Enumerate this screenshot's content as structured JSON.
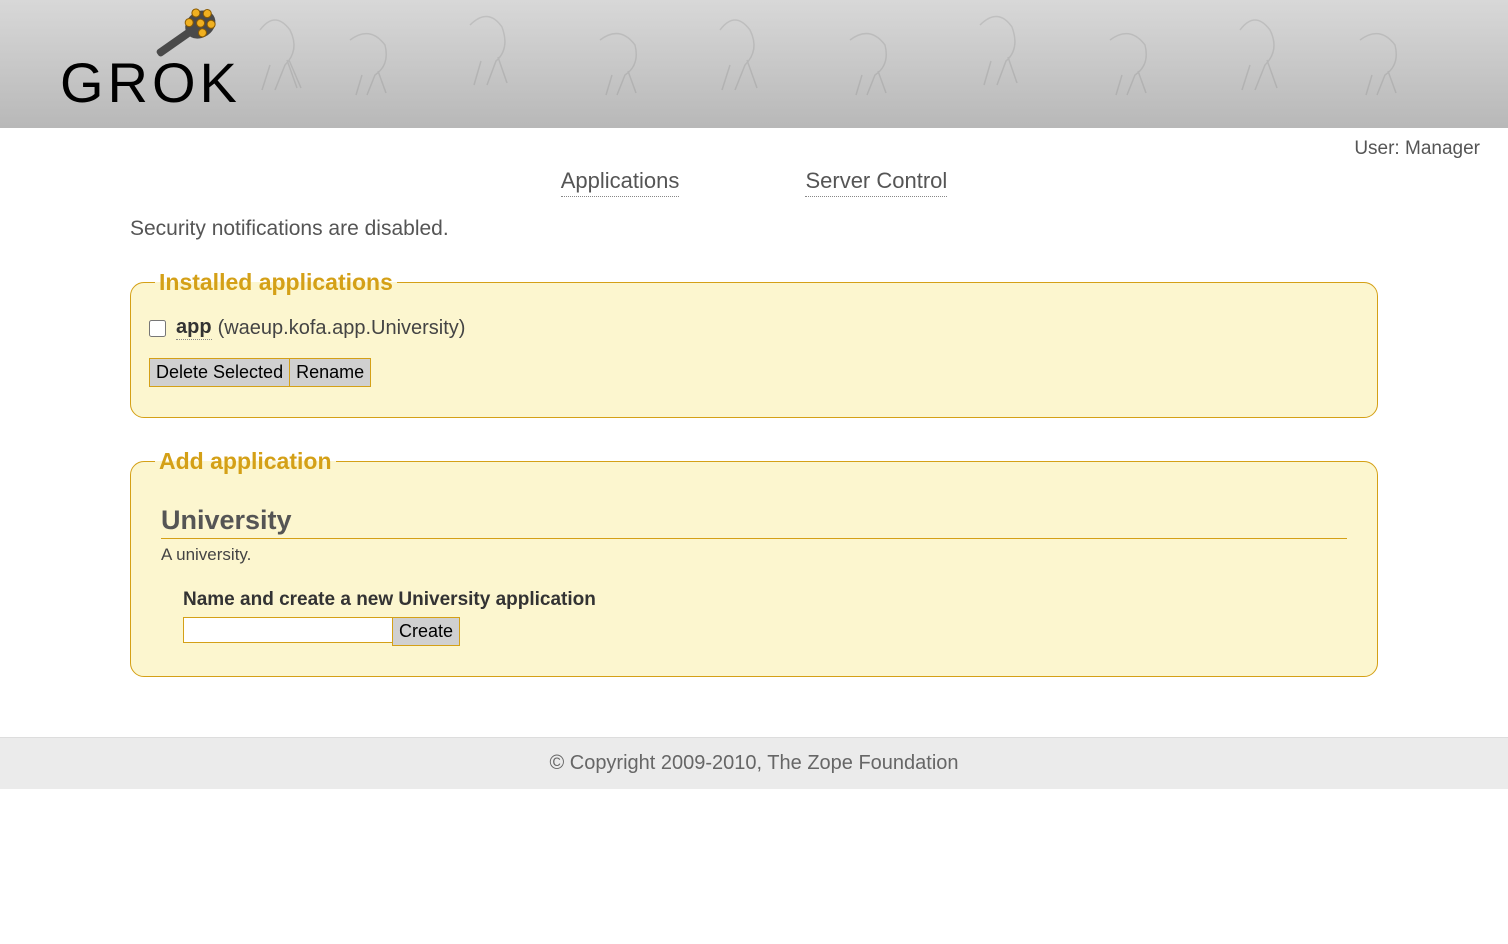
{
  "header": {
    "logo_text": "GROK"
  },
  "user_bar": {
    "label": "User:",
    "username": "Manager"
  },
  "nav": {
    "applications": "Applications",
    "server_control": "Server Control"
  },
  "security_msg": "Security notifications are disabled.",
  "installed": {
    "legend": "Installed applications",
    "apps": [
      {
        "name": "app",
        "class": "(waeup.kofa.app.University)"
      }
    ],
    "delete_btn": "Delete Selected",
    "rename_btn": "Rename"
  },
  "add": {
    "legend": "Add application",
    "title": "University",
    "description": "A university.",
    "create_label": "Name and create a new University application",
    "name_value": "",
    "create_btn": "Create"
  },
  "footer": "© Copyright 2009-2010, The Zope Foundation"
}
